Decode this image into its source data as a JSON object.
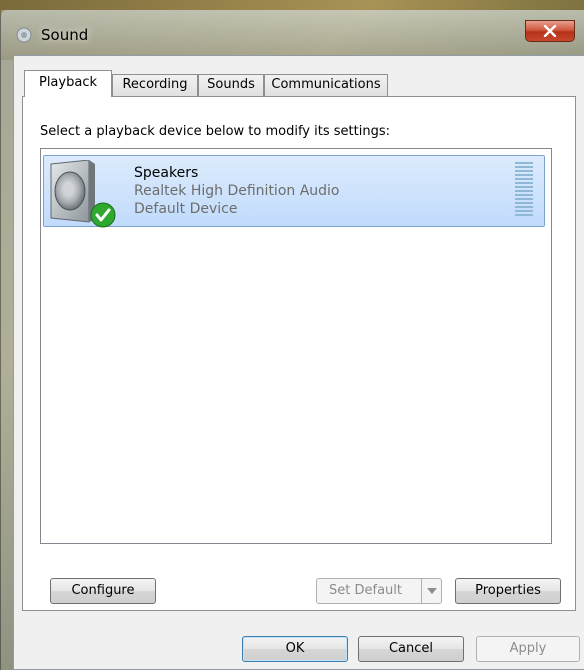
{
  "window": {
    "title": "Sound",
    "close_label": "x"
  },
  "tabs": [
    {
      "label": "Playback",
      "active": true
    },
    {
      "label": "Recording",
      "active": false
    },
    {
      "label": "Sounds",
      "active": false
    },
    {
      "label": "Communications",
      "active": false
    }
  ],
  "playback": {
    "instruction": "Select a playback device below to modify its settings:",
    "devices": [
      {
        "name": "Speakers",
        "driver": "Realtek High Definition Audio",
        "status": "Default Device",
        "icon": "speaker-icon",
        "status_icon": "check-icon",
        "selected": true
      }
    ],
    "buttons": {
      "configure": "Configure",
      "set_default": "Set Default",
      "properties": "Properties"
    }
  },
  "dialog_buttons": {
    "ok": "OK",
    "cancel": "Cancel",
    "apply": "Apply"
  },
  "colors": {
    "selection_border": "#7da2ce",
    "selection_fill": "#c1dbfc",
    "close_button": "#c9482d",
    "check_green": "#2ea82e"
  }
}
